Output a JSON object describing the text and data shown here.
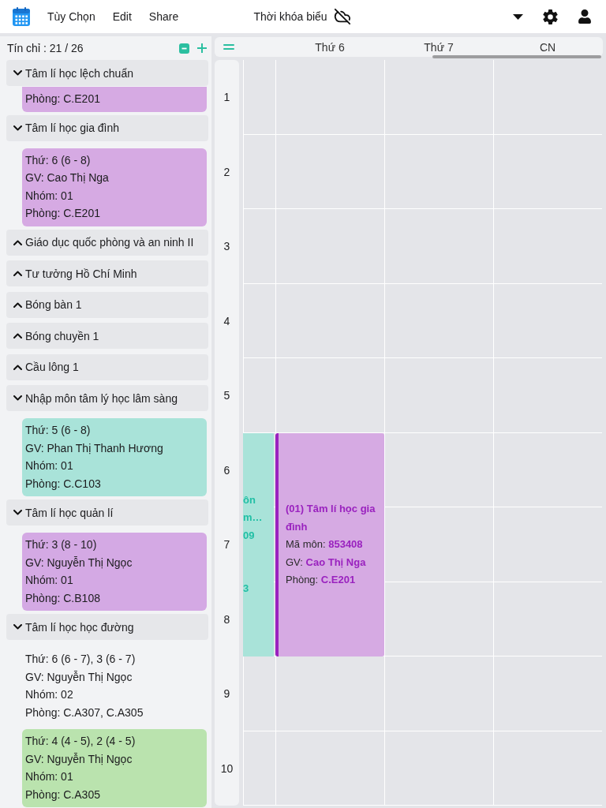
{
  "toolbar": {
    "menu": [
      "Tùy Chọn",
      "Edit",
      "Share"
    ],
    "title": "Thời khóa biểu"
  },
  "sidebar": {
    "credits": "Tín chỉ : 21 / 26",
    "courses": [
      {
        "name": "Tâm lí học lệch chuẩn",
        "expanded": true,
        "options": [
          {
            "lines": [
              "Phòng: C.E201"
            ],
            "selected": true,
            "color": "#d6aae3"
          }
        ]
      },
      {
        "name": "Tâm lí học gia đình",
        "expanded": true,
        "options": [
          {
            "lines": [
              "Thứ: 6 (6 - 8)",
              "GV: Cao Thị Nga",
              "Nhóm: 01",
              "Phòng: C.E201"
            ],
            "selected": true,
            "color": "#d6aae3"
          }
        ]
      },
      {
        "name": "Giáo dục quốc phòng và an ninh II",
        "expanded": false
      },
      {
        "name": "Tư tưởng Hồ Chí Minh",
        "expanded": false
      },
      {
        "name": "Bóng bàn 1",
        "expanded": false
      },
      {
        "name": "Bóng chuyền 1",
        "expanded": false
      },
      {
        "name": "Cầu lông 1",
        "expanded": false
      },
      {
        "name": "Nhập môn tâm lý học lâm sàng",
        "expanded": true,
        "options": [
          {
            "lines": [
              "Thứ: 5 (6 - 8)",
              "GV: Phan Thị Thanh Hương",
              "Nhóm: 01",
              "Phòng: C.C103"
            ],
            "selected": true,
            "color": "#a9e3d9"
          }
        ]
      },
      {
        "name": "Tâm lí học quản lí",
        "expanded": true,
        "options": [
          {
            "lines": [
              "Thứ: 3 (8 - 10)",
              "GV: Nguyễn Thị Ngọc",
              "Nhóm: 01",
              "Phòng: C.B108"
            ],
            "selected": true,
            "color": "#d4a9e4"
          }
        ]
      },
      {
        "name": "Tâm lí học học đường",
        "expanded": true,
        "options": [
          {
            "lines": [
              "Thứ: 6 (6 - 7), 3 (6 - 7)",
              "GV: Nguyễn Thị Ngọc",
              "Nhóm: 02",
              "Phòng: C.A307, C.A305"
            ],
            "selected": false
          },
          {
            "lines": [
              "Thứ: 4 (4 - 5), 2 (4 - 5)",
              "GV: Nguyễn Thị Ngọc",
              "Nhóm: 01",
              "Phòng: C.A305"
            ],
            "selected": true,
            "color": "#bae3ae"
          }
        ]
      }
    ]
  },
  "timetable": {
    "periods": [
      "1",
      "2",
      "3",
      "4",
      "5",
      "6",
      "7",
      "8",
      "9",
      "10"
    ],
    "cut_off_column": {
      "events": [
        {
          "lines": [
            "ôn",
            "m…",
            "09",
            "3"
          ],
          "color": "#a9e3d9"
        }
      ]
    },
    "days": [
      {
        "label": "Thứ 6",
        "events": [
          {
            "title": "(01) Tâm lí học gia đình",
            "details": [
              "Mã môn: **853408**",
              "GV: **Cao Thị Nga**",
              "Phòng: **C.E201**"
            ],
            "color": "#d6aae3"
          }
        ]
      },
      {
        "label": "Thứ 7"
      },
      {
        "label": "CN"
      }
    ]
  }
}
